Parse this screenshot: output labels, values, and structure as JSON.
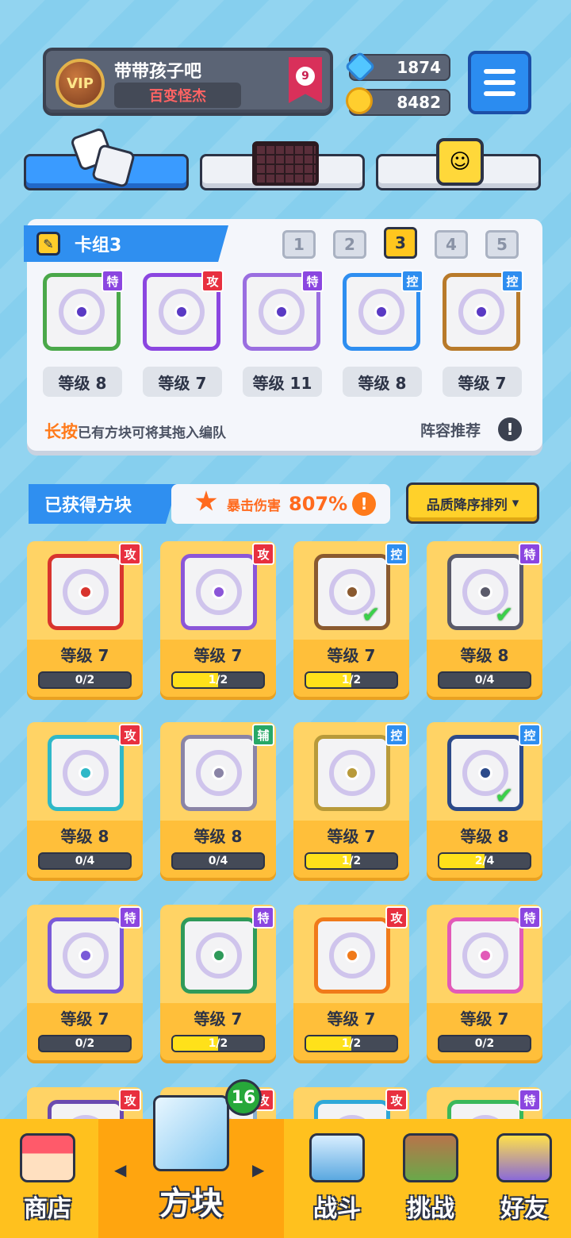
{
  "player": {
    "vip_label": "VIP",
    "name": "带带孩子吧",
    "title": "百变怪杰",
    "rank": "9"
  },
  "currency": {
    "gems": "1874",
    "coins": "8482"
  },
  "category_tabs": [
    {
      "icon": "dice-icon",
      "active": true
    },
    {
      "icon": "chocolate-grid-icon",
      "active": false
    },
    {
      "icon": "smiley-block-icon",
      "active": false
    }
  ],
  "deck": {
    "title": "卡组3",
    "numbers": [
      "1",
      "2",
      "3",
      "4",
      "5"
    ],
    "active_number": "3",
    "slots": [
      {
        "tag": "特",
        "tag_type": "te",
        "level": "等级 8",
        "color": "#4aa84a"
      },
      {
        "tag": "攻",
        "tag_type": "gong",
        "level": "等级 7",
        "color": "#8b46e0"
      },
      {
        "tag": "特",
        "tag_type": "te",
        "level": "等级 11",
        "color": "#9a6ee0"
      },
      {
        "tag": "控",
        "tag_type": "kong",
        "level": "等级 8",
        "color": "#2e8ef0"
      },
      {
        "tag": "控",
        "tag_type": "kong",
        "level": "等级 7",
        "color": "#b87a2a"
      }
    ],
    "hint_emphasis": "长按",
    "hint_text": "已有方块可将其拖入编队",
    "recommend_label": "阵容推荐"
  },
  "owned": {
    "title": "已获得方块",
    "crit_label": "暴击伤害",
    "crit_value": "807%",
    "sort_label": "品质降序排列"
  },
  "cards": [
    {
      "tag": "攻",
      "tag_type": "gong",
      "level": "等级 7",
      "progress": "0/2",
      "fill": 0,
      "color": "#d8342e",
      "checked": false
    },
    {
      "tag": "攻",
      "tag_type": "gong",
      "level": "等级 7",
      "progress": "1/2",
      "fill": 0.5,
      "color": "#8b56d8",
      "checked": false
    },
    {
      "tag": "控",
      "tag_type": "kong",
      "level": "等级 7",
      "progress": "1/2",
      "fill": 0.5,
      "color": "#8a5a30",
      "checked": true
    },
    {
      "tag": "特",
      "tag_type": "te",
      "level": "等级 8",
      "progress": "0/4",
      "fill": 0,
      "color": "#5a5a6a",
      "checked": true
    },
    {
      "tag": "攻",
      "tag_type": "gong",
      "level": "等级 8",
      "progress": "0/4",
      "fill": 0,
      "color": "#2fb8c8",
      "checked": false
    },
    {
      "tag": "辅",
      "tag_type": "fu",
      "level": "等级 8",
      "progress": "0/4",
      "fill": 0,
      "color": "#8a84a6",
      "checked": false
    },
    {
      "tag": "控",
      "tag_type": "kong",
      "level": "等级 7",
      "progress": "1/2",
      "fill": 0.5,
      "color": "#b89a3a",
      "checked": false
    },
    {
      "tag": "控",
      "tag_type": "kong",
      "level": "等级 8",
      "progress": "2/4",
      "fill": 0.5,
      "color": "#2c4a8a",
      "checked": true
    },
    {
      "tag": "特",
      "tag_type": "te",
      "level": "等级 7",
      "progress": "0/2",
      "fill": 0,
      "color": "#7a5ad8",
      "checked": false
    },
    {
      "tag": "特",
      "tag_type": "te",
      "level": "等级 7",
      "progress": "1/2",
      "fill": 0.5,
      "color": "#2f9a5a",
      "checked": false
    },
    {
      "tag": "攻",
      "tag_type": "gong",
      "level": "等级 7",
      "progress": "1/2",
      "fill": 0.5,
      "color": "#f07a1a",
      "checked": false
    },
    {
      "tag": "特",
      "tag_type": "te",
      "level": "等级 7",
      "progress": "0/2",
      "fill": 0,
      "color": "#e25ab8",
      "checked": false
    },
    {
      "tag": "攻",
      "tag_type": "gong",
      "level": "",
      "progress": "",
      "fill": 0,
      "color": "#6a4ab0",
      "checked": false
    },
    {
      "tag": "攻",
      "tag_type": "gong",
      "level": "",
      "progress": "",
      "fill": 0,
      "color": "#8ab0d0",
      "checked": false
    },
    {
      "tag": "攻",
      "tag_type": "gong",
      "level": "",
      "progress": "",
      "fill": 0,
      "color": "#2fa8d8",
      "checked": false
    },
    {
      "tag": "特",
      "tag_type": "te",
      "level": "",
      "progress": "",
      "fill": 0,
      "color": "#3ab85a",
      "checked": false
    }
  ],
  "bottom_nav": {
    "shop": "商店",
    "blocks": "方块",
    "battle": "战斗",
    "challenge": "挑战",
    "friends": "好友",
    "blocks_badge": "16",
    "left_arrow": "◀",
    "right_arrow": "▶"
  }
}
